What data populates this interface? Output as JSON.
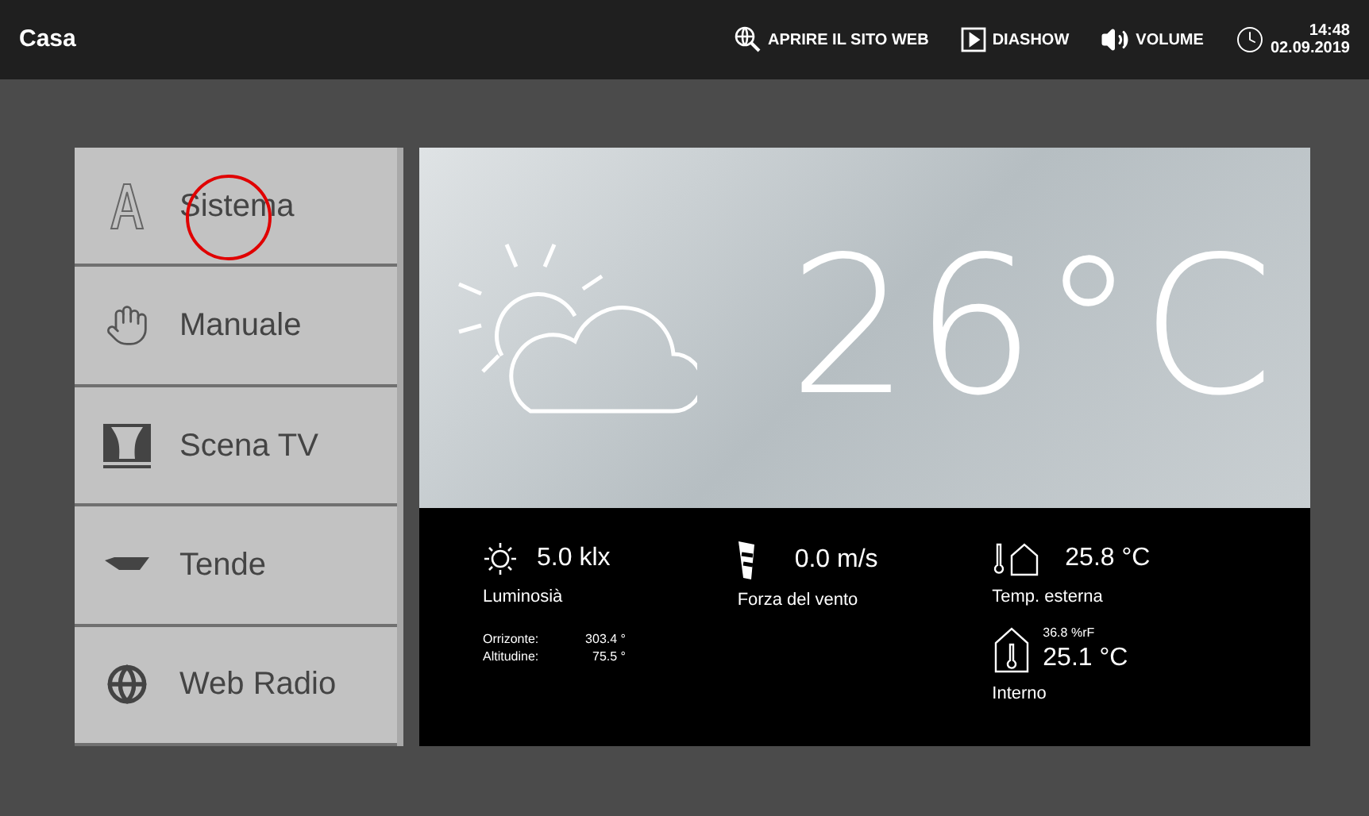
{
  "header": {
    "title": "Casa",
    "actions": [
      {
        "kind": "web",
        "label": "APRIRE IL SITO WEB"
      },
      {
        "kind": "slideshow",
        "label": "DIASHOW"
      },
      {
        "kind": "volume",
        "label": "VOLUME"
      }
    ],
    "time": "14:48",
    "date": "02.09.2019"
  },
  "menu": [
    {
      "kind": "font",
      "label": "Sistema",
      "touched": true
    },
    {
      "kind": "hand",
      "label": "Manuale",
      "touched": false
    },
    {
      "kind": "stage",
      "label": "Scena TV",
      "touched": false
    },
    {
      "kind": "awning",
      "label": "Tende",
      "touched": false
    },
    {
      "kind": "globe",
      "label": "Web Radio",
      "touched": false
    }
  ],
  "weather": {
    "temperature": "26°C",
    "luminosity": {
      "value": "5.0 klx",
      "label": "Luminosià",
      "rows": [
        {
          "label": "Orrizonte:",
          "value": "303.4 °"
        },
        {
          "label": "Altitudine:",
          "value": "75.5 °"
        }
      ]
    },
    "wind": {
      "value": "0.0 m/s",
      "label": "Forza del vento"
    },
    "outside": {
      "value": "25.8 °C",
      "label": "Temp. esterna"
    },
    "inside": {
      "humidity": "36.8 %rF",
      "value": "25.1 °C",
      "label": "Interno"
    }
  }
}
